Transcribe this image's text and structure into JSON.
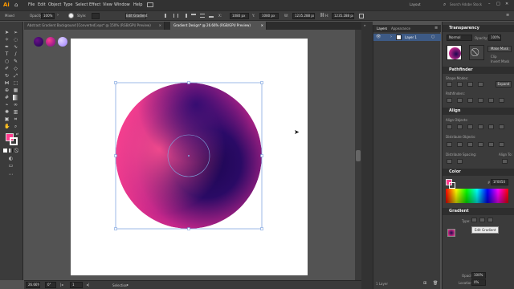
{
  "app": {
    "logo": "Ai"
  },
  "menu": [
    "File",
    "Edit",
    "Object",
    "Type",
    "Select",
    "Effect",
    "View",
    "Window",
    "Help"
  ],
  "workspace": {
    "name": "Layout",
    "search_placeholder": "Search Adobe Stock"
  },
  "control": {
    "selection": "Mixed",
    "opacity_label": "Opacity:",
    "opacity_value": "100%",
    "style_label": "Style:",
    "edit_gradient": "Edit Gradient",
    "x_value": "1080 px",
    "y_value": "1080 px",
    "w_value": "1235.288 px",
    "h_value": "1235.288 px"
  },
  "tabs": [
    {
      "label": "Abstract Gradient Background [Converted].eps* @ 150% (RGB/GPU Preview)",
      "active": false
    },
    {
      "label": "Gradient Design* @ 26.66% (RGB/GPU Preview)",
      "active": true
    }
  ],
  "status": {
    "zoom": "26.66%",
    "rotate": "0°",
    "artboard": "1",
    "tool": "Selection"
  },
  "layers": {
    "tabs": [
      "Layers",
      "Appearance"
    ],
    "layer_name": "Layer 1",
    "footer": "1 Layer"
  },
  "transparency": {
    "title": "Transparency",
    "blend_mode": "Normal",
    "opacity_label": "Opacity:",
    "opacity_value": "100%",
    "make_mask": "Make Mask",
    "clip": "Clip",
    "invert_mask": "Invert Mask"
  },
  "pathfinder": {
    "title": "Pathfinder",
    "shape_modes": "Shape Modes:",
    "pathfinders": "Pathfinders:",
    "expand": "Expand"
  },
  "align": {
    "title": "Align",
    "align_objects": "Align Objects:",
    "distribute_objects": "Distribute Objects:",
    "distribute_spacing": "Distribute Spacing:",
    "align_to": "Align To:"
  },
  "color": {
    "title": "Color",
    "hex": "1F0050"
  },
  "gradient": {
    "title": "Gradient",
    "type_label": "Type:",
    "tooltip": "Edit Gradient",
    "opacity_label": "Opacity:",
    "opacity_value": "100%",
    "location_label": "Location:",
    "location_value": "0%"
  },
  "colors": {
    "grad_dark": "#1b0650",
    "grad_mid": "#6a0f87",
    "grad_pink": "#ff3d8f",
    "accent_blue": "#2d5fb5"
  }
}
